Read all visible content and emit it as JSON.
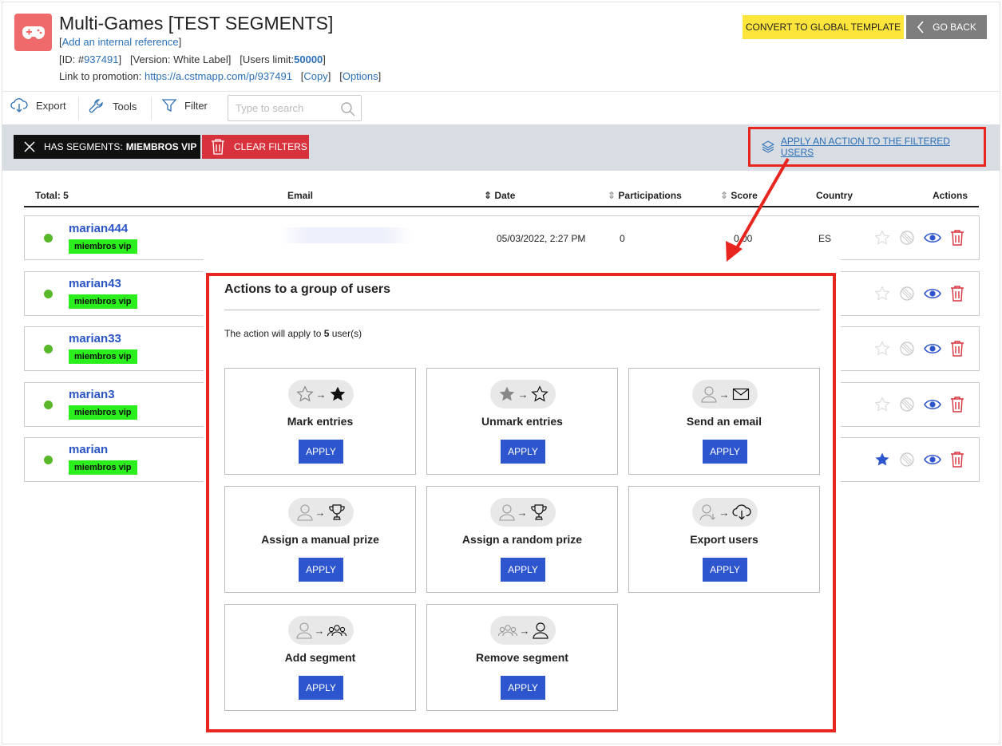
{
  "header": {
    "title": "Multi-Games [TEST SEGMENTS]",
    "internal_ref": "Add an internal reference",
    "id_prefix": "[ID: #",
    "id_value": "937491",
    "id_suffix": "]",
    "version": "[Version: White Label]",
    "users_limit_prefix": "[Users limit:",
    "users_limit_value": "50000",
    "users_limit_suffix": "]",
    "promo_label": "Link to promotion:",
    "promo_url": "https://a.cstmapp.com/p/937491",
    "copy": "Copy",
    "options": "Options",
    "convert_btn": "CONVERT TO GLOBAL TEMPLATE",
    "back_btn": "GO BACK"
  },
  "toolbar": {
    "export": "Export",
    "tools": "Tools",
    "filter": "Filter",
    "search_placeholder": "Type to search"
  },
  "filters": {
    "segment_prefix": "HAS SEGMENTS:",
    "segment_value": "MIEMBROS VIP",
    "clear": "CLEAR FILTERS",
    "apply_action": "APPLY AN ACTION TO THE FILTERED USERS"
  },
  "table": {
    "headers": {
      "total": "Total: 5",
      "email": "Email",
      "date": "Date",
      "participations": "Participations",
      "score": "Score",
      "country": "Country",
      "actions": "Actions"
    },
    "rows": [
      {
        "name": "marian444",
        "tag": "miembros vip",
        "date": "05/03/2022, 2:27 PM",
        "participations": "0",
        "score": "0.00",
        "country": "ES",
        "starred": false
      },
      {
        "name": "marian43",
        "tag": "miembros vip",
        "starred": false
      },
      {
        "name": "marian33",
        "tag": "miembros vip",
        "starred": false
      },
      {
        "name": "marian3",
        "tag": "miembros vip",
        "starred": false
      },
      {
        "name": "marian",
        "tag": "miembros vip",
        "starred": true
      }
    ]
  },
  "modal": {
    "title": "Actions to a group of users",
    "sub_prefix": "The action will apply to ",
    "sub_count": "5",
    "sub_suffix": " user(s)",
    "cards": [
      {
        "label": "Mark entries",
        "button": "APPLY",
        "icon_from": "star-outline-icon",
        "icon_to": "star-filled-icon"
      },
      {
        "label": "Unmark entries",
        "button": "APPLY",
        "icon_from": "star-filled-gray-icon",
        "icon_to": "star-outline-icon"
      },
      {
        "label": "Send an email",
        "button": "APPLY",
        "icon_from": "user-icon",
        "icon_to": "envelope-icon"
      },
      {
        "label": "Assign a manual prize",
        "button": "APPLY",
        "icon_from": "user-icon",
        "icon_to": "trophy-icon"
      },
      {
        "label": "Assign a random prize",
        "button": "APPLY",
        "icon_from": "user-icon",
        "icon_to": "trophy-icon"
      },
      {
        "label": "Export users",
        "button": "APPLY",
        "icon_from": "user-download-icon",
        "icon_to": "cloud-download-icon"
      },
      {
        "label": "Add segment",
        "button": "APPLY",
        "icon_from": "user-icon",
        "icon_to": "group-icon"
      },
      {
        "label": "Remove segment",
        "button": "APPLY",
        "icon_from": "group-icon",
        "icon_to": "user-icon"
      }
    ],
    "arrow_glyph": "→"
  },
  "colors": {
    "accent_blue": "#2d55cd",
    "link_blue": "#2a6fb8",
    "highlight_red": "#e8261f",
    "tag_green": "#2bee1d",
    "status_green": "#59b82a",
    "delete_red": "#d8333d"
  }
}
